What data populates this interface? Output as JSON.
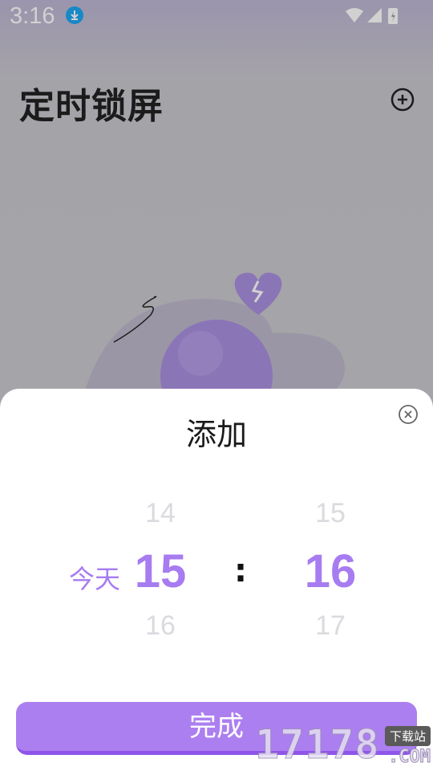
{
  "status_bar": {
    "time": "3:16",
    "icons": [
      "download-icon",
      "wifi-icon",
      "signal-icon",
      "battery-charging-icon"
    ]
  },
  "app": {
    "title": "定时锁屏",
    "add_icon": "plus-circle-icon",
    "illustration_icons": [
      "broken-heart-icon",
      "sphere-illustration"
    ]
  },
  "sheet": {
    "title": "添加",
    "close_icon": "close-circle-icon",
    "day_label": "今天",
    "separator": ":",
    "hour": {
      "prev": "14",
      "selected": "15",
      "next": "16"
    },
    "minute": {
      "prev": "15",
      "selected": "16",
      "next": "17"
    },
    "done_label": "完成"
  },
  "watermark": {
    "digits": "17178",
    "badge": "下载站",
    "suffix": ".COM"
  },
  "colors": {
    "accent": "#a77cf0",
    "button": "#ac7ff0",
    "button_shadow": "#8f55ea",
    "faded_text": "#dadadf"
  }
}
